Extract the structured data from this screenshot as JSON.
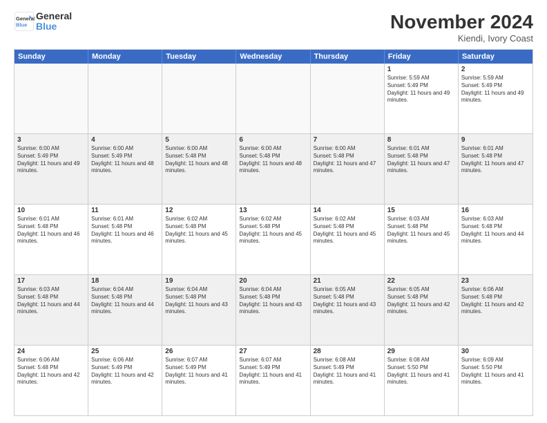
{
  "logo": {
    "line1": "General",
    "line2": "Blue"
  },
  "title": "November 2024",
  "location": "Kiendi, Ivory Coast",
  "header": {
    "days": [
      "Sunday",
      "Monday",
      "Tuesday",
      "Wednesday",
      "Thursday",
      "Friday",
      "Saturday"
    ]
  },
  "weeks": [
    [
      {
        "day": "",
        "empty": true
      },
      {
        "day": "",
        "empty": true
      },
      {
        "day": "",
        "empty": true
      },
      {
        "day": "",
        "empty": true
      },
      {
        "day": "",
        "empty": true
      },
      {
        "day": "1",
        "sunrise": "Sunrise: 5:59 AM",
        "sunset": "Sunset: 5:49 PM",
        "daylight": "Daylight: 11 hours and 49 minutes."
      },
      {
        "day": "2",
        "sunrise": "Sunrise: 5:59 AM",
        "sunset": "Sunset: 5:49 PM",
        "daylight": "Daylight: 11 hours and 49 minutes."
      }
    ],
    [
      {
        "day": "3",
        "sunrise": "Sunrise: 6:00 AM",
        "sunset": "Sunset: 5:49 PM",
        "daylight": "Daylight: 11 hours and 49 minutes."
      },
      {
        "day": "4",
        "sunrise": "Sunrise: 6:00 AM",
        "sunset": "Sunset: 5:49 PM",
        "daylight": "Daylight: 11 hours and 48 minutes."
      },
      {
        "day": "5",
        "sunrise": "Sunrise: 6:00 AM",
        "sunset": "Sunset: 5:48 PM",
        "daylight": "Daylight: 11 hours and 48 minutes."
      },
      {
        "day": "6",
        "sunrise": "Sunrise: 6:00 AM",
        "sunset": "Sunset: 5:48 PM",
        "daylight": "Daylight: 11 hours and 48 minutes."
      },
      {
        "day": "7",
        "sunrise": "Sunrise: 6:00 AM",
        "sunset": "Sunset: 5:48 PM",
        "daylight": "Daylight: 11 hours and 47 minutes."
      },
      {
        "day": "8",
        "sunrise": "Sunrise: 6:01 AM",
        "sunset": "Sunset: 5:48 PM",
        "daylight": "Daylight: 11 hours and 47 minutes."
      },
      {
        "day": "9",
        "sunrise": "Sunrise: 6:01 AM",
        "sunset": "Sunset: 5:48 PM",
        "daylight": "Daylight: 11 hours and 47 minutes."
      }
    ],
    [
      {
        "day": "10",
        "sunrise": "Sunrise: 6:01 AM",
        "sunset": "Sunset: 5:48 PM",
        "daylight": "Daylight: 11 hours and 46 minutes."
      },
      {
        "day": "11",
        "sunrise": "Sunrise: 6:01 AM",
        "sunset": "Sunset: 5:48 PM",
        "daylight": "Daylight: 11 hours and 46 minutes."
      },
      {
        "day": "12",
        "sunrise": "Sunrise: 6:02 AM",
        "sunset": "Sunset: 5:48 PM",
        "daylight": "Daylight: 11 hours and 45 minutes."
      },
      {
        "day": "13",
        "sunrise": "Sunrise: 6:02 AM",
        "sunset": "Sunset: 5:48 PM",
        "daylight": "Daylight: 11 hours and 45 minutes."
      },
      {
        "day": "14",
        "sunrise": "Sunrise: 6:02 AM",
        "sunset": "Sunset: 5:48 PM",
        "daylight": "Daylight: 11 hours and 45 minutes."
      },
      {
        "day": "15",
        "sunrise": "Sunrise: 6:03 AM",
        "sunset": "Sunset: 5:48 PM",
        "daylight": "Daylight: 11 hours and 45 minutes."
      },
      {
        "day": "16",
        "sunrise": "Sunrise: 6:03 AM",
        "sunset": "Sunset: 5:48 PM",
        "daylight": "Daylight: 11 hours and 44 minutes."
      }
    ],
    [
      {
        "day": "17",
        "sunrise": "Sunrise: 6:03 AM",
        "sunset": "Sunset: 5:48 PM",
        "daylight": "Daylight: 11 hours and 44 minutes."
      },
      {
        "day": "18",
        "sunrise": "Sunrise: 6:04 AM",
        "sunset": "Sunset: 5:48 PM",
        "daylight": "Daylight: 11 hours and 44 minutes."
      },
      {
        "day": "19",
        "sunrise": "Sunrise: 6:04 AM",
        "sunset": "Sunset: 5:48 PM",
        "daylight": "Daylight: 11 hours and 43 minutes."
      },
      {
        "day": "20",
        "sunrise": "Sunrise: 6:04 AM",
        "sunset": "Sunset: 5:48 PM",
        "daylight": "Daylight: 11 hours and 43 minutes."
      },
      {
        "day": "21",
        "sunrise": "Sunrise: 6:05 AM",
        "sunset": "Sunset: 5:48 PM",
        "daylight": "Daylight: 11 hours and 43 minutes."
      },
      {
        "day": "22",
        "sunrise": "Sunrise: 6:05 AM",
        "sunset": "Sunset: 5:48 PM",
        "daylight": "Daylight: 11 hours and 42 minutes."
      },
      {
        "day": "23",
        "sunrise": "Sunrise: 6:06 AM",
        "sunset": "Sunset: 5:48 PM",
        "daylight": "Daylight: 11 hours and 42 minutes."
      }
    ],
    [
      {
        "day": "24",
        "sunrise": "Sunrise: 6:06 AM",
        "sunset": "Sunset: 5:48 PM",
        "daylight": "Daylight: 11 hours and 42 minutes."
      },
      {
        "day": "25",
        "sunrise": "Sunrise: 6:06 AM",
        "sunset": "Sunset: 5:49 PM",
        "daylight": "Daylight: 11 hours and 42 minutes."
      },
      {
        "day": "26",
        "sunrise": "Sunrise: 6:07 AM",
        "sunset": "Sunset: 5:49 PM",
        "daylight": "Daylight: 11 hours and 41 minutes."
      },
      {
        "day": "27",
        "sunrise": "Sunrise: 6:07 AM",
        "sunset": "Sunset: 5:49 PM",
        "daylight": "Daylight: 11 hours and 41 minutes."
      },
      {
        "day": "28",
        "sunrise": "Sunrise: 6:08 AM",
        "sunset": "Sunset: 5:49 PM",
        "daylight": "Daylight: 11 hours and 41 minutes."
      },
      {
        "day": "29",
        "sunrise": "Sunrise: 6:08 AM",
        "sunset": "Sunset: 5:50 PM",
        "daylight": "Daylight: 11 hours and 41 minutes."
      },
      {
        "day": "30",
        "sunrise": "Sunrise: 6:09 AM",
        "sunset": "Sunset: 5:50 PM",
        "daylight": "Daylight: 11 hours and 41 minutes."
      }
    ]
  ]
}
